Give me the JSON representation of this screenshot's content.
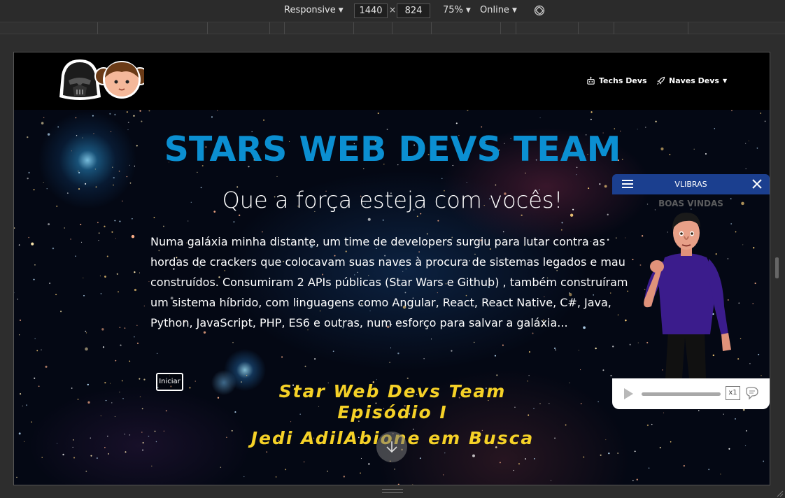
{
  "devtools": {
    "device": "Responsive",
    "width": "1440",
    "height": "824",
    "zoom": "75%",
    "throttle": "Online",
    "rotate_icon": "rotate-icon"
  },
  "site": {
    "nav": {
      "logo_icon": "darth-vader-and-leia-logo",
      "links": [
        {
          "label": "Techs Devs",
          "icon": "robot-icon"
        },
        {
          "label": "Naves Devs",
          "icon": "rocket-icon",
          "dropdown": true
        }
      ]
    },
    "hero": {
      "title": "STARS WEB DEVS TEAM",
      "subtitle": "Que a força esteja com vocês!",
      "text": "Numa galáxia minha distante, um time de developers surgiu para lutar contra as hordas de crackers que colocavam suas naves à procura de sistemas legados e mau construídos. Consumiram 2 APIs públicas (Star Wars e Github) , também construíram um sistema híbrido, com linguagens como Angular, React, React Native, C#, Java, Python, JavaScript, PHP, ES6 e outras, num esforço para salvar a galáxia...",
      "button": "Iniciar",
      "crawl": [
        "Star Web Devs Team",
        "Episódio I",
        "Jedi AdilAbione em Busca"
      ]
    }
  },
  "vlibras": {
    "title": "VLIBRAS",
    "welcome": "BOAS VINDAS",
    "speed": "x1",
    "progress": 0
  },
  "colors": {
    "title": "#0b8fd1",
    "crawl": "#f5d127",
    "vlibras_header": "#1b3f8f"
  }
}
